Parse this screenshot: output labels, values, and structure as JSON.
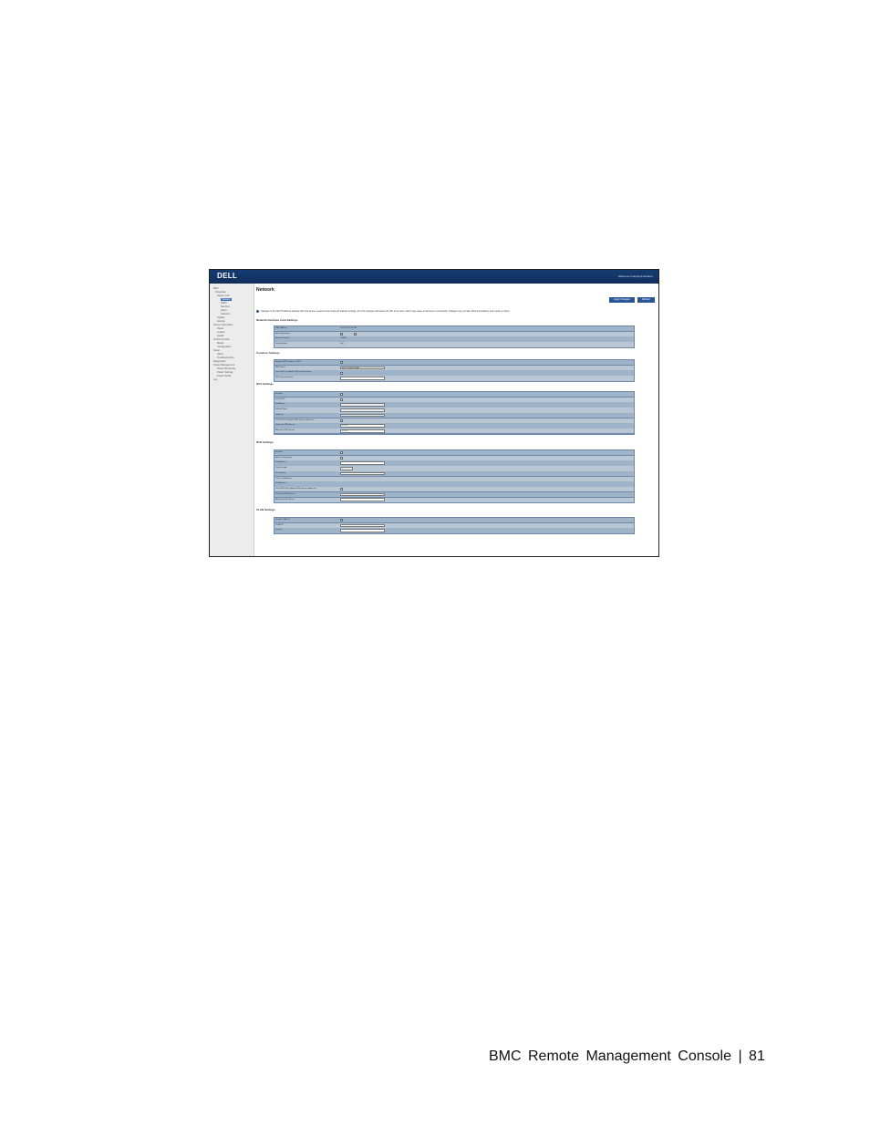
{
  "header": {
    "logo": "DELL",
    "welcome": "Welcome root(Administrator)"
  },
  "sidebar": {
    "items": [
      "BMC",
      "Properties",
      "System Info",
      "Network",
      "SMTP",
      "Services",
      "Users",
      "Sessions",
      "Update",
      "License",
      "Server Information",
      "Power",
      "Locator",
      "Health",
      "Virtual Console",
      "Media",
      "Configuration",
      "Setup",
      "Alerts",
      "Troubleshooting",
      "Diagnostics",
      "Power Management",
      "Power Monitoring",
      "Power Settings",
      "Power Profile",
      "Log"
    ],
    "selected_index": 3
  },
  "main": {
    "title": "Network",
    "buttons": {
      "apply": "Apply Changes",
      "refresh": "Refresh"
    },
    "note": "Changes to the NIC IP address settings will close all user sessions and require IP address settings. All of the changes will require the NIC to be reset, which may cause a brief loss in connectivity. Changes may not take effect immediately, and require a reboot.",
    "sections": [
      {
        "title": "Network Interface Card Settings",
        "rows": [
          {
            "label": "MAC Address",
            "value": "00:25:90:7F:9F:A6"
          },
          {
            "label": "Auto Negotiation",
            "value": ""
          },
          {
            "label": "Network Speed",
            "value": "100Mb"
          },
          {
            "label": "Duplex Mode",
            "value": "Full"
          }
        ]
      },
      {
        "title": "Common Settings",
        "rows": [
          {
            "label": "Register BMC Name to DNS",
            "value": ""
          },
          {
            "label": "BMC Name",
            "value": "BMC-0025907F9FA6"
          },
          {
            "label": "Use DHCP to obtain DNS Domain Name",
            "value": ""
          },
          {
            "label": "DNS Domain Name",
            "value": ""
          }
        ]
      },
      {
        "title": "IPv4 Settings",
        "rows": [
          {
            "label": "Enabled",
            "value": ""
          },
          {
            "label": "Use DHCP",
            "value": ""
          },
          {
            "label": "IP Address",
            "value": ""
          },
          {
            "label": "Subnet Mask",
            "value": ""
          },
          {
            "label": "Gateway",
            "value": ""
          },
          {
            "label": "Use DHCP to obtain DNS Server addresses",
            "value": ""
          },
          {
            "label": "Preferred DNS Server",
            "value": "0.0.0.0"
          },
          {
            "label": "Alternate DNS Server",
            "value": "0.0.0.0"
          }
        ]
      },
      {
        "title": "IPv6 Settings",
        "rows": [
          {
            "label": "Enabled",
            "value": ""
          },
          {
            "label": "Auto Configuration",
            "value": ""
          },
          {
            "label": "IP Address 1",
            "value": ""
          },
          {
            "label": "Prefix Length",
            "value": "64"
          },
          {
            "label": "IP Gateway",
            "value": ""
          },
          {
            "label": "Link Local Address",
            "value": ""
          },
          {
            "label": "IP Address 2",
            "value": ""
          },
          {
            "label": "Use DHCPv6 to obtain DNS Server addresses",
            "value": ""
          },
          {
            "label": "Preferred DNS Server",
            "value": ""
          },
          {
            "label": "Alternate DNS Server",
            "value": ""
          }
        ]
      },
      {
        "title": "VLAN Settings",
        "rows": [
          {
            "label": "Enable VLAN ID",
            "value": ""
          },
          {
            "label": "VLAN ID",
            "value": ""
          },
          {
            "label": "Priority",
            "value": ""
          }
        ]
      }
    ]
  },
  "footer": {
    "text": "BMC  Remote  Management  Console  |  81"
  }
}
